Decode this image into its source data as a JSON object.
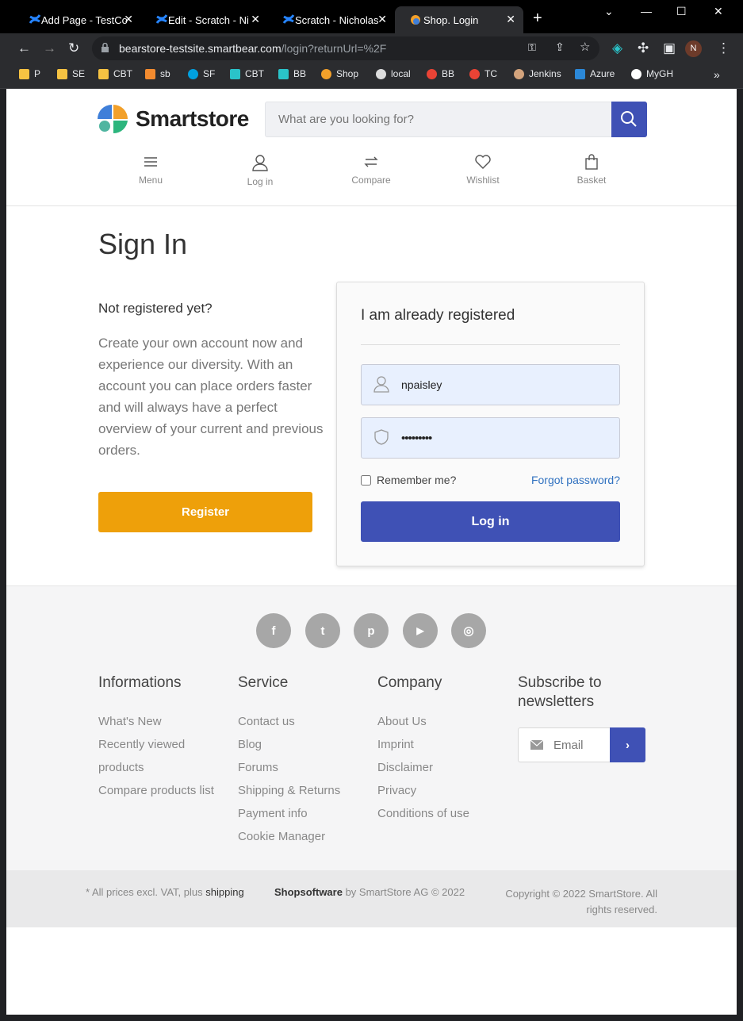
{
  "browser": {
    "tabs": [
      {
        "label": "Add Page - TestCo"
      },
      {
        "label": "Edit - Scratch - Ni"
      },
      {
        "label": "Scratch - Nicholas"
      },
      {
        "label": "Shop. Login"
      }
    ],
    "url_host": "bearstore-testsite.smartbear.com",
    "url_path": "/login?returnUrl=%2F",
    "profile_initial": "N",
    "bookmarks": [
      {
        "label": "P",
        "color": "#f6c342"
      },
      {
        "label": "SE",
        "color": "#f6c342"
      },
      {
        "label": "CBT",
        "color": "#f6c342"
      },
      {
        "label": "sb",
        "color": "#f38b2f"
      },
      {
        "label": "SF",
        "color": "#00a1e0"
      },
      {
        "label": "CBT",
        "color": "#2ac3c9"
      },
      {
        "label": "BB",
        "color": "#2ac3c9"
      },
      {
        "label": "Shop",
        "color": "#f2a02a"
      },
      {
        "label": "local",
        "color": "#dddddd"
      },
      {
        "label": "BB",
        "color": "#ea4335"
      },
      {
        "label": "TC",
        "color": "#ea4335"
      },
      {
        "label": "Jenkins",
        "color": "#d3a37c"
      },
      {
        "label": "Azure",
        "color": "#2b88d8"
      },
      {
        "label": "MyGH",
        "color": "#ffffff"
      }
    ]
  },
  "header": {
    "logo_text": "Smartstore",
    "search_placeholder": "What are you looking for?",
    "nav": [
      "Menu",
      "Log in",
      "Compare",
      "Wishlist",
      "Basket"
    ]
  },
  "main": {
    "title": "Sign In",
    "not_registered": "Not registered yet?",
    "not_registered_text": "Create your own account now and experience our diversity. With an account you can place orders faster and will always have a perfect overview of your current and previous orders.",
    "register_label": "Register",
    "login_card": {
      "title": "I am already registered",
      "username": "npaisley",
      "password": "•••••••••",
      "remember_label": "Remember me?",
      "forgot_label": "Forgot password?",
      "login_label": "Log in"
    }
  },
  "footer": {
    "social": [
      "f",
      "t",
      "p",
      "▶",
      "◎"
    ],
    "columns": [
      {
        "title": "Informations",
        "links": [
          "What's New",
          "Recently viewed products",
          "Compare products list"
        ]
      },
      {
        "title": "Service",
        "links": [
          "Contact us",
          "Blog",
          "Forums",
          "Shipping & Returns",
          "Payment info",
          "Cookie Manager"
        ]
      },
      {
        "title": "Company",
        "links": [
          "About Us",
          "Imprint",
          "Disclaimer",
          "Privacy",
          "Conditions of use"
        ]
      }
    ],
    "newsletter_title": "Subscribe to newsletters",
    "email_placeholder": "Email",
    "prices_note": "* All prices excl. VAT, plus ",
    "shipping_link": "shipping",
    "shopsoftware": "Shopsoftware",
    "by_text": " by SmartStore AG © 2022",
    "copyright_1": "Copyright © 2022 SmartStore. All",
    "copyright_2": "rights reserved."
  },
  "colors": {
    "primary": "#3f51b5",
    "register": "#eea00a"
  }
}
